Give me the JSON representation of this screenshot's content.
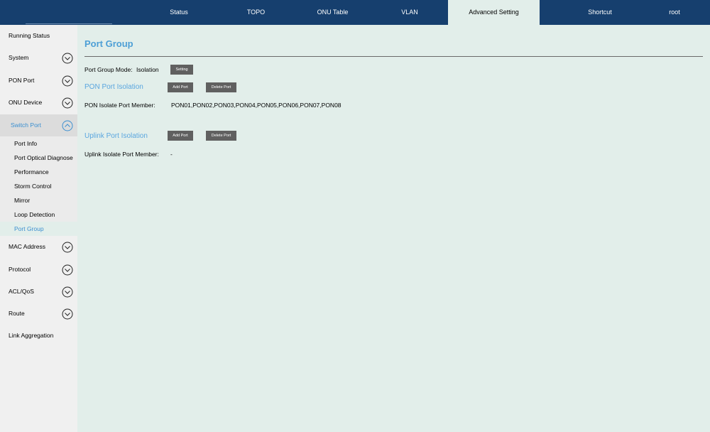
{
  "header": {
    "tabs": [
      {
        "label": "Status"
      },
      {
        "label": "TOPO"
      },
      {
        "label": "ONU Table"
      },
      {
        "label": "VLAN"
      },
      {
        "label": "Advanced Setting"
      },
      {
        "label": "Shortcut"
      },
      {
        "label": "root"
      }
    ],
    "active_tab": "Advanced Setting"
  },
  "sidebar": {
    "items": [
      {
        "label": "Running Status"
      },
      {
        "label": "System"
      },
      {
        "label": "PON Port"
      },
      {
        "label": "ONU Device"
      },
      {
        "label": "Switch Port"
      },
      {
        "label": "MAC Address"
      },
      {
        "label": "Protocol"
      },
      {
        "label": "ACL/QoS"
      },
      {
        "label": "Route"
      },
      {
        "label": "Link Aggregation"
      }
    ],
    "switch_port_subitems": [
      {
        "label": "Port Info"
      },
      {
        "label": "Port Optical Diagnose"
      },
      {
        "label": "Performance"
      },
      {
        "label": "Storm Control"
      },
      {
        "label": "Mirror"
      },
      {
        "label": "Loop Detection"
      },
      {
        "label": "Port Group"
      }
    ],
    "active_subitem": "Port Group"
  },
  "main": {
    "title": "Port Group",
    "mode_label": "Port Group Mode:",
    "mode_value": "Isolation",
    "setting_button": "Setting",
    "pon_section": {
      "title": "PON Port Isolation",
      "add_button": "Add Port",
      "delete_button": "Delete Port",
      "member_label": "PON Isolate Port Member:",
      "member_value": "PON01,PON02,PON03,PON04,PON05,PON06,PON07,PON08"
    },
    "uplink_section": {
      "title": "Uplink Port Isolation",
      "add_button": "Add Port",
      "delete_button": "Delete Port",
      "member_label": "Uplink Isolate Port Member:",
      "member_value": "-"
    }
  },
  "colors": {
    "header_bg": "#163f6e",
    "content_bg": "#e2eeea",
    "sidebar_bg": "#f0f0f0",
    "accent": "#4d9fd6",
    "button_bg": "#606060"
  }
}
